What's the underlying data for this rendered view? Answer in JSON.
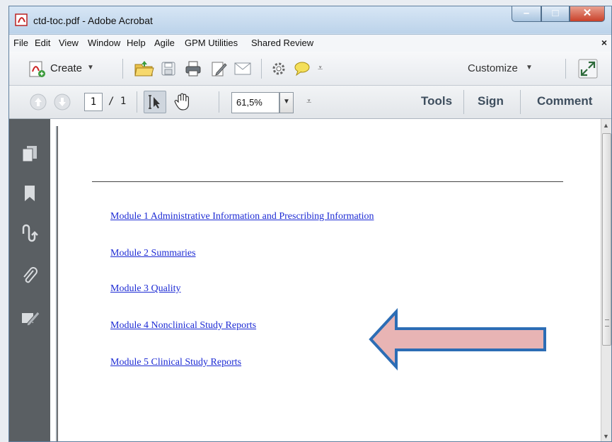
{
  "window": {
    "title": "ctd-toc.pdf - Adobe Acrobat"
  },
  "menubar": {
    "items": [
      "File",
      "Edit",
      "View",
      "Window",
      "Help",
      "Agile",
      "GPM Utilities",
      "Shared Review"
    ],
    "close_glyph": "×"
  },
  "toolbar": {
    "create_label": "Create",
    "customize_label": "Customize",
    "page_current": "1",
    "page_total": "/ 1",
    "zoom_value": "61,5%",
    "tabs": {
      "tools": "Tools",
      "sign": "Sign",
      "comment": "Comment"
    }
  },
  "sidebar": {
    "icons": [
      "pages-icon",
      "bookmark-icon",
      "signatures-icon",
      "attachment-icon",
      "content-edit-icon"
    ]
  },
  "document": {
    "links": [
      "Module 1 Administrative Information and Prescribing Information",
      "Module 2 Summaries",
      "Module 3 Quality",
      "Module 4 Nonclinical Study Reports",
      "Module 5 Clinical Study Reports"
    ]
  },
  "annotation": {
    "arrow_fill": "#e8b4b4",
    "arrow_stroke": "#2c6db5"
  },
  "colors": {
    "link": "#1d2bd4",
    "sidebar": "#5a5f63",
    "titlebar": "#c9dcef"
  }
}
